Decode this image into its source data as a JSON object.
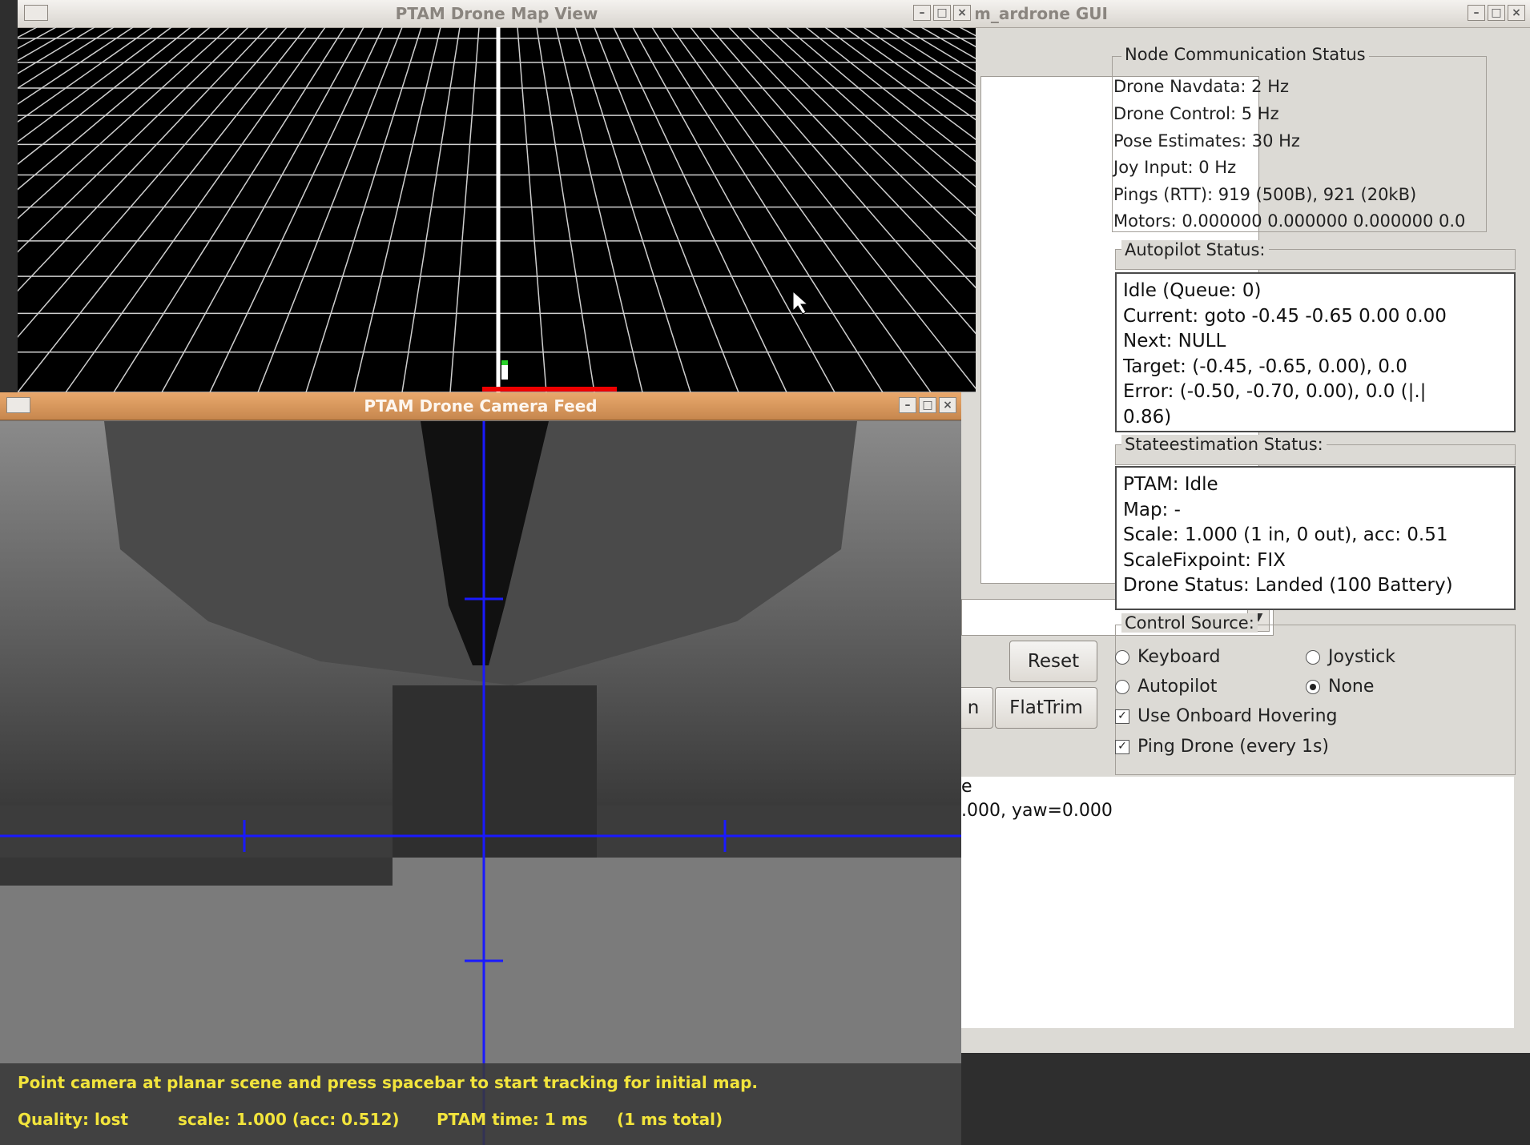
{
  "gui": {
    "title": "m_ardrone GUI",
    "buttons": {
      "reset": "Reset",
      "flattrim": "FlatTrim",
      "partial": "n"
    },
    "node_comm": {
      "label": "Node Communication  Status",
      "lines": [
        "Drone Navdata: 2 Hz",
        "Drone Control: 5 Hz",
        "Pose Estimates: 30 Hz",
        "Joy Input: 0 Hz",
        "Pings (RTT): 919 (500B), 921 (20kB)",
        "Motors: 0.000000 0.000000 0.000000 0.0"
      ]
    },
    "autopilot": {
      "label": "Autopilot Status:",
      "lines": [
        "Idle (Queue: 0)",
        "Current: goto -0.45 -0.65 0.00 0.00",
        "Next: NULL",
        "Target: (-0.45,  -0.65,  0.00), 0.0",
        "Error: (-0.50,  -0.70,  0.00), 0.0 (|.|",
        "0.86)"
      ]
    },
    "stateestimation": {
      "label": "Stateestimation Status:",
      "lines": [
        "PTAM: Idle",
        "Map: -",
        "Scale: 1.000 (1 in, 0 out), acc: 0.51",
        "ScaleFixpoint: FIX",
        "Drone Status: Landed (100 Battery)"
      ]
    },
    "control_source": {
      "label": "Control Source:",
      "keyboard": "Keyboard",
      "joystick": "Joystick",
      "autopilot": "Autopilot",
      "none": "None",
      "selected": "None"
    },
    "checkboxes": {
      "onboard_hovering": "Use Onboard Hovering",
      "ping_drone": "Ping Drone (every 1s)"
    },
    "bottom_text": {
      "line1": "e",
      "line2": ".000,  yaw=0.000"
    }
  },
  "map_view": {
    "title": "PTAM Drone Map View"
  },
  "camera_feed": {
    "title": "PTAM Drone Camera Feed",
    "hud_line1": "Point camera at planar scene and press spacebar to start tracking for initial map.",
    "hud_quality": "Quality: lost",
    "hud_scale": "scale: 1.000 (acc: 0.512)",
    "hud_time": "PTAM time: 1 ms",
    "hud_total": "(1 ms total)"
  },
  "colors": {
    "crosshair": "#1a1aff",
    "hud_text": "#f2e43c",
    "camera_title_bar": "#d48f55"
  }
}
